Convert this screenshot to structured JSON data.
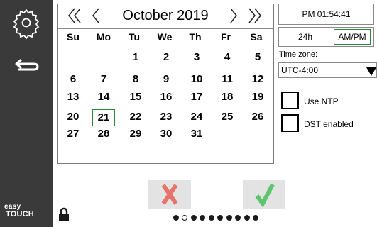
{
  "brand": {
    "line1": "easy",
    "line2": "TOUCH"
  },
  "calendar": {
    "month_title": "October 2019",
    "weekdays": [
      "Su",
      "Mo",
      "Tu",
      "We",
      "Th",
      "Fr",
      "Sa"
    ],
    "selected_day": "21",
    "days": [
      "1",
      "2",
      "3",
      "4",
      "5",
      "6",
      "7",
      "8",
      "9",
      "10",
      "11",
      "12",
      "13",
      "14",
      "15",
      "16",
      "17",
      "18",
      "19",
      "20",
      "21",
      "22",
      "23",
      "24",
      "25",
      "26",
      "27",
      "28",
      "29",
      "30",
      "31"
    ]
  },
  "clock": {
    "time": "PM 01:54:41",
    "format_24h_label": "24h",
    "format_ampm_label": "AM/PM",
    "selected_format": "AM/PM"
  },
  "timezone": {
    "label": "Time zone:",
    "value": "UTC-4:00"
  },
  "options": {
    "ntp_label": "Use NTP",
    "ntp_checked": false,
    "dst_label": "DST enabled",
    "dst_checked": false
  },
  "pager": {
    "total": 10,
    "current": 1
  },
  "colors": {
    "sidebar": "#3a3a3a",
    "selection": "#2e8b3d",
    "cancel": "#e8736b",
    "confirm": "#5ec46e"
  },
  "icons": {
    "settings": "gear-icon",
    "back": "back-arrow-icon",
    "lock": "lock-icon",
    "cancel": "x-icon",
    "confirm": "checkmark-icon"
  }
}
